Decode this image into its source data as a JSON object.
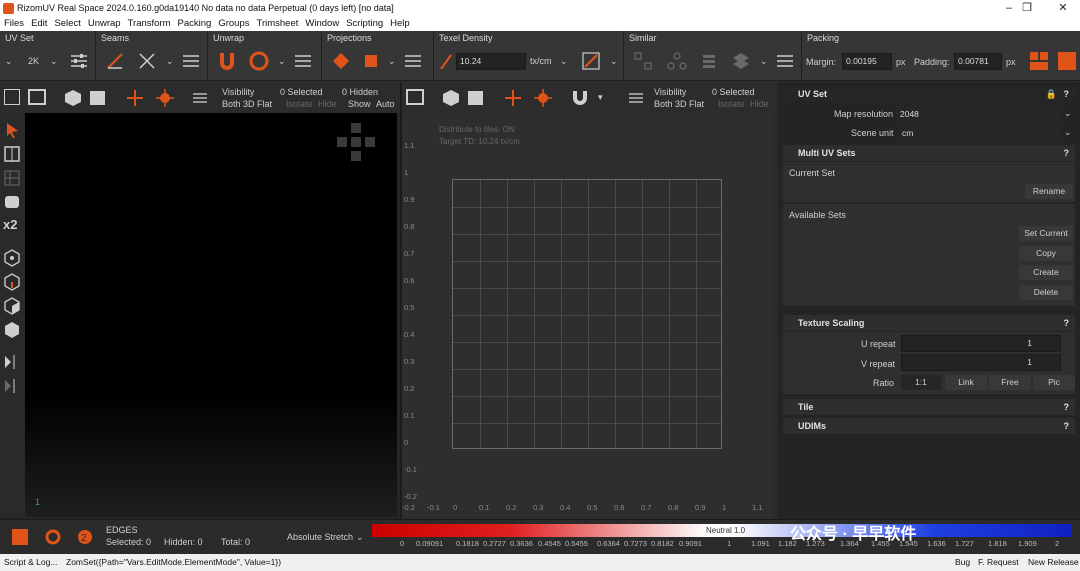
{
  "titlebar": {
    "title": "RizomUV  Real Space 2024.0.160.g0da19140 No data no data Perpetual  (0 days left) [no data]",
    "minimize": "–",
    "maximize": "❐",
    "close": "✕"
  },
  "menu": [
    "Files",
    "Edit",
    "Select",
    "Unwrap",
    "Transform",
    "Packing",
    "Groups",
    "Trimsheet",
    "Window",
    "Scripting",
    "Help"
  ],
  "toolbar": {
    "groups": {
      "uvset": "UV Set",
      "seams": "Seams",
      "unwrap": "Unwrap",
      "projections": "Projections",
      "texel": "Texel Density",
      "similar": "Similar",
      "packing": "Packing"
    },
    "uvset_size": "2K",
    "texel_value": "10.24",
    "texel_unit": "tx/cm",
    "margin_label": "Margin:",
    "margin_value": "0.00195",
    "margin_unit": "px",
    "padding_label": "Padding:",
    "padding_value": "0.00781",
    "padding_unit": "px"
  },
  "left_viewport": {
    "visibility": "Visibility",
    "visibility_value": "Both 3D Flat",
    "selected": "0 Selected",
    "isolate": "Isolate",
    "hide": "Hide",
    "hidden": "0 Hidden",
    "show": "Show",
    "auto": "Auto",
    "axis_label": "1"
  },
  "uv_viewport": {
    "visibility": "Visibility",
    "visibility_value": "Both 3D Flat",
    "selected": "0 Selected",
    "isolate": "Isolate",
    "hide": "Hide",
    "overlay_line1": "Distribute to tiles: ON",
    "overlay_line2": "Target TD: 10.24 tx/cm",
    "y_ticks": [
      "1.1",
      "1",
      "0.9",
      "0.8",
      "0.7",
      "0.6",
      "0.5",
      "0.4",
      "0.3",
      "0.2",
      "0.1",
      "0",
      "-0.1",
      "-0.2"
    ],
    "x_ticks": [
      "-0.2",
      "-0.1",
      "0",
      "0.1",
      "0.2",
      "0.3",
      "0.4",
      "0.5",
      "0.6",
      "0.7",
      "0.8",
      "0.9",
      "1",
      "1.1"
    ]
  },
  "right_panel": {
    "uv_set_title": "UV Set",
    "map_resolution_label": "Map resolution",
    "map_resolution_value": "2048",
    "scene_unit_label": "Scene unit",
    "scene_unit_value": "cm",
    "multi_uv_title": "Multi UV Sets",
    "current_set_label": "Current Set",
    "rename": "Rename",
    "available_sets_label": "Available Sets",
    "set_current": "Set Current",
    "copy": "Copy",
    "create": "Create",
    "delete": "Delete",
    "texture_scaling_title": "Texture Scaling",
    "u_repeat_label": "U repeat",
    "u_repeat_value": "1",
    "v_repeat_label": "V repeat",
    "v_repeat_value": "1",
    "ratio_label": "Ratio",
    "ratio_value": "1:1",
    "link": "Link",
    "free": "Free",
    "pic": "Pic",
    "tile_title": "Tile",
    "udims_title": "UDIMs",
    "help": "?"
  },
  "status": {
    "mode": "EDGES",
    "selected": "Selected: 0",
    "hidden": "Hidden: 0",
    "total": "Total: 0",
    "stretch_mode": "Absolute Stretch",
    "neutral": "Neutral 1.0",
    "scale": [
      "0",
      "0.09091",
      "0.1818",
      "0.2727",
      "0.3636",
      "0.4545",
      "0.5455",
      "0.6364",
      "0.7273",
      "0.8182",
      "0.9091",
      "1",
      "1.091",
      "1.182",
      "1.273",
      "1.364",
      "1.455",
      "1.545",
      "1.636",
      "1.727",
      "1.818",
      "1.909",
      "2"
    ],
    "watermark": "公众号 · 早早软件"
  },
  "scriptbar": {
    "label": "Script & Log...",
    "command": "ZomSet({Path=\"Vars.EditMode.ElementMode\", Value=1})",
    "bug": "Bug",
    "feature": "F. Request",
    "new_release": "New Release"
  },
  "colors": {
    "accent": "#e0541a",
    "background": "#2b2b2b",
    "panel": "#2f2f2f"
  }
}
